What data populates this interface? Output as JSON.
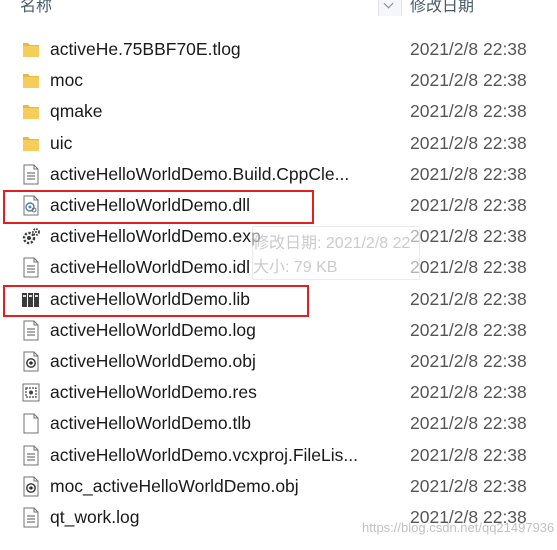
{
  "header": {
    "name_label": "名称",
    "date_label": "修改日期"
  },
  "rows": [
    {
      "name": "activeHe.75BBF70E.tlog",
      "date": "2021/2/8 22:38",
      "icon": "folder-icon"
    },
    {
      "name": "moc",
      "date": "2021/2/8 22:38",
      "icon": "folder-icon"
    },
    {
      "name": "qmake",
      "date": "2021/2/8 22:38",
      "icon": "folder-icon"
    },
    {
      "name": "uic",
      "date": "2021/2/8 22:38",
      "icon": "folder-icon"
    },
    {
      "name": "activeHelloWorldDemo.Build.CppCle...",
      "date": "2021/2/8 22:38",
      "icon": "text-file-icon"
    },
    {
      "name": "activeHelloWorldDemo.dll",
      "date": "2021/2/8 22:38",
      "icon": "dll-file-icon"
    },
    {
      "name": "activeHelloWorldDemo.exp",
      "date": "2021/2/8 22:38",
      "icon": "gear-file-icon"
    },
    {
      "name": "activeHelloWorldDemo.idl",
      "date": "2021/2/8 22:38",
      "icon": "text-file-icon"
    },
    {
      "name": "activeHelloWorldDemo.lib",
      "date": "2021/2/8 22:38",
      "icon": "library-icon"
    },
    {
      "name": "activeHelloWorldDemo.log",
      "date": "2021/2/8 22:38",
      "icon": "text-file-icon"
    },
    {
      "name": "activeHelloWorldDemo.obj",
      "date": "2021/2/8 22:38",
      "icon": "object-file-icon"
    },
    {
      "name": "activeHelloWorldDemo.res",
      "date": "2021/2/8 22:38",
      "icon": "resource-file-icon"
    },
    {
      "name": "activeHelloWorldDemo.tlb",
      "date": "2021/2/8 22:38",
      "icon": "blank-file-icon"
    },
    {
      "name": "activeHelloWorldDemo.vcxproj.FileLis...",
      "date": "2021/2/8 22:38",
      "icon": "text-file-icon"
    },
    {
      "name": "moc_activeHelloWorldDemo.obj",
      "date": "2021/2/8 22:38",
      "icon": "object-file-icon"
    },
    {
      "name": "qt_work.log",
      "date": "2021/2/8 22:38",
      "icon": "text-file-icon"
    }
  ],
  "tooltip": {
    "line1": "修改日期: 2021/2/8 22",
    "line2": "大小: 79 KB"
  },
  "watermark": "https://blog.csdn.net/qq21497936",
  "colors": {
    "highlight": "#e02020",
    "folder": "#f5cd5b"
  }
}
